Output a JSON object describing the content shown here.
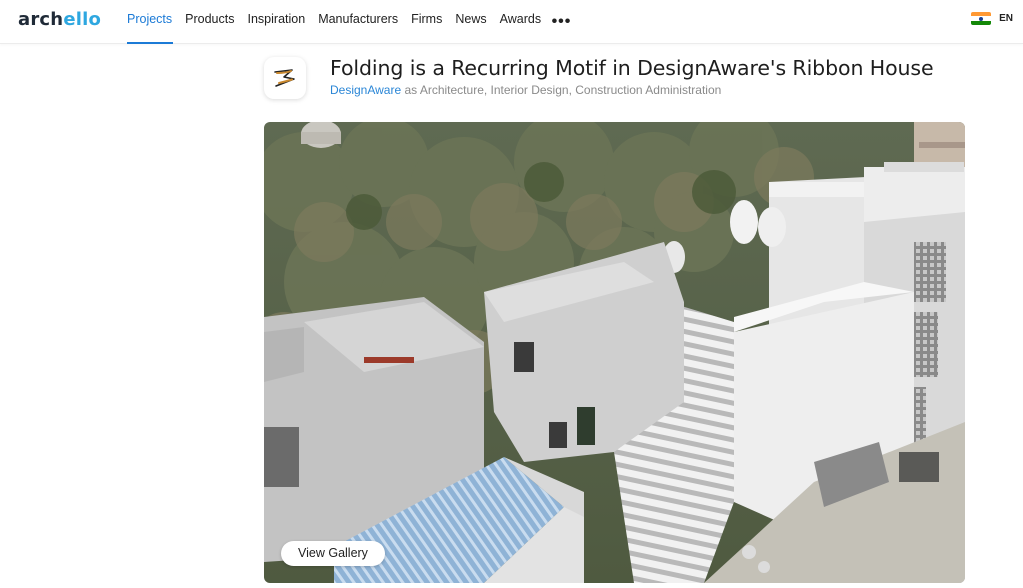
{
  "header": {
    "logo": {
      "part1": "arch",
      "part2": "ello"
    },
    "nav": [
      {
        "label": "Projects",
        "active": true
      },
      {
        "label": "Products"
      },
      {
        "label": "Inspiration"
      },
      {
        "label": "Manufacturers"
      },
      {
        "label": "Firms"
      },
      {
        "label": "News"
      },
      {
        "label": "Awards"
      }
    ],
    "more": "•••",
    "language": {
      "flag": "india-flag-icon",
      "label": "EN"
    }
  },
  "project": {
    "title": "Folding is a Recurring Motif in DesignAware's Ribbon House",
    "firm": "DesignAware",
    "roles_text": " as Architecture, Interior Design, Construction Administration",
    "gallery_button": "View Gallery"
  },
  "colors": {
    "accent": "#1b7ad6",
    "brand_blue": "#2ea7e0",
    "link": "#2a86d6"
  }
}
